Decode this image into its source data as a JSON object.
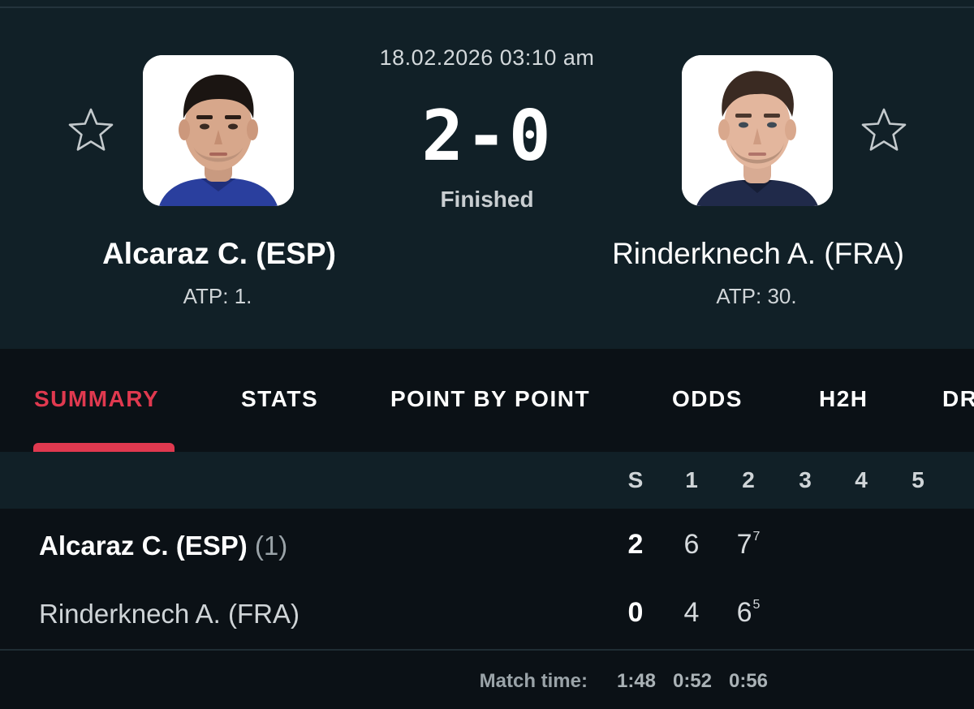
{
  "match": {
    "datetime": "18.02.2026 03:10 am",
    "score": "2-0",
    "status": "Finished"
  },
  "home": {
    "name": "Alcaraz C. (ESP)",
    "rank": "ATP: 1.",
    "seed": "(1)",
    "sets": "2",
    "set1": "6",
    "set2": "7",
    "set2_tiebreak": "7"
  },
  "away": {
    "name": "Rinderknech A. (FRA)",
    "rank": "ATP: 30.",
    "sets": "0",
    "set1": "4",
    "set2": "6",
    "set2_tiebreak": "5"
  },
  "tabs": [
    {
      "label": "SUMMARY",
      "active": true
    },
    {
      "label": "STATS"
    },
    {
      "label": "POINT BY POINT"
    },
    {
      "label": "ODDS"
    },
    {
      "label": "H2H"
    },
    {
      "label": "DR"
    }
  ],
  "table": {
    "columns": [
      "S",
      "1",
      "2",
      "3",
      "4",
      "5"
    ]
  },
  "match_time": {
    "label": "Match time:",
    "total": "1:48",
    "set1": "0:52",
    "set2": "0:56"
  },
  "icons": {
    "favorite": "star-outline-icon"
  },
  "colors": {
    "accent": "#e0394f",
    "header_bg": "#112027",
    "page_bg": "#0b1116"
  }
}
